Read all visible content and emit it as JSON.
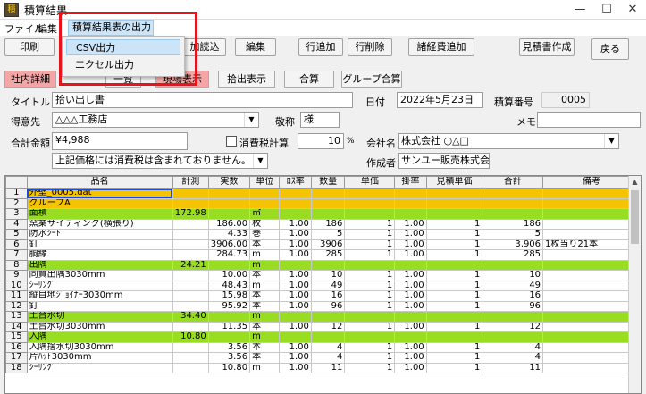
{
  "window": {
    "title": "積算結果",
    "app_icon": "積"
  },
  "menu": {
    "file": "ファイル",
    "edit": "編集",
    "export_menu": "積算結果表の出力"
  },
  "export_dropdown": {
    "csv": "CSV出力",
    "excel": "エクセル出力"
  },
  "toolbar": {
    "print": "印刷",
    "import_partial": "加読込",
    "edit": "編集",
    "add_row": "行追加",
    "delete_row": "行削除",
    "add_expense": "諸経費追加",
    "create_estimate": "見積書作成",
    "back": "戻る"
  },
  "tabs": {
    "internal_detail": "社内詳細",
    "tab2": "一覧",
    "tab3": "現場表示",
    "extract_display": "拾出表示",
    "total": "合算",
    "group_total": "グループ合算"
  },
  "form": {
    "title_label": "タイトル",
    "title_value": "拾い出し書",
    "date_label": "日付",
    "date_value": "2022年5月23日",
    "estimate_no_label": "積算番号",
    "estimate_no_value": "0005",
    "customer_label": "得意先",
    "customer_value": "△△△工務店",
    "honorific_label": "敬称",
    "honorific_value": "様",
    "memo_label": "メモ",
    "memo_value": "",
    "total_label": "合計金額",
    "total_value": "¥4,988",
    "tax_label": "消費税計算",
    "tax_rate": "10",
    "tax_unit": "%",
    "company_label": "会社名",
    "company_value": "株式会社 ○△□",
    "tax_note": "上記価格には消費税は含まれておりません。",
    "author_label": "作成者",
    "author_value": "サンユー販売株式会社"
  },
  "grid": {
    "headers": [
      "",
      "品名",
      "計測",
      "実数",
      "単位",
      "ﾛｽ率",
      "数量",
      "単価",
      "掛率",
      "見積単価",
      "合計",
      "備考"
    ],
    "rows": [
      {
        "type": "yellow",
        "cells": [
          "1",
          "外壁_0005.dat",
          "",
          "",
          "",
          "",
          "",
          "",
          "",
          "",
          "",
          ""
        ]
      },
      {
        "type": "yellow",
        "cells": [
          "2",
          "グループA",
          "",
          "",
          "",
          "",
          "",
          "",
          "",
          "",
          "",
          ""
        ]
      },
      {
        "type": "green",
        "cells": [
          "3",
          "面積",
          "172.98",
          "",
          "㎡",
          "",
          "",
          "",
          "",
          "",
          "",
          ""
        ]
      },
      {
        "type": "white",
        "cells": [
          "4",
          "窯業サイディング(横張り)",
          "",
          "186.00",
          "枚",
          "1.00",
          "186",
          "1",
          "1.00",
          "1",
          "186",
          ""
        ]
      },
      {
        "type": "white",
        "cells": [
          "5",
          "防水ｼｰﾄ",
          "",
          "4.33",
          "巻",
          "1.00",
          "5",
          "1",
          "1.00",
          "1",
          "5",
          ""
        ]
      },
      {
        "type": "white",
        "cells": [
          "6",
          "釘",
          "",
          "3906.00",
          "本",
          "1.00",
          "3906",
          "1",
          "1.00",
          "1",
          "3,906",
          "1枚当り21本"
        ]
      },
      {
        "type": "white",
        "cells": [
          "7",
          "胴縁",
          "",
          "284.73",
          "m",
          "1.00",
          "285",
          "1",
          "1.00",
          "1",
          "285",
          ""
        ]
      },
      {
        "type": "green",
        "cells": [
          "8",
          "出隅",
          "24.21",
          "",
          "m",
          "",
          "",
          "",
          "",
          "",
          "",
          ""
        ]
      },
      {
        "type": "white",
        "cells": [
          "9",
          "同質出隅3030mm",
          "",
          "10.00",
          "本",
          "1.00",
          "10",
          "1",
          "1.00",
          "1",
          "10",
          ""
        ]
      },
      {
        "type": "white",
        "cells": [
          "10",
          "ｼｰﾘﾝｸﾞ",
          "",
          "48.43",
          "m",
          "1.00",
          "49",
          "1",
          "1.00",
          "1",
          "49",
          ""
        ]
      },
      {
        "type": "white",
        "cells": [
          "11",
          "縦目地ｼﾞｮｲﾅｰ3030mm",
          "",
          "15.98",
          "本",
          "1.00",
          "16",
          "1",
          "1.00",
          "1",
          "16",
          ""
        ]
      },
      {
        "type": "white",
        "cells": [
          "12",
          "釘",
          "",
          "95.92",
          "本",
          "1.00",
          "96",
          "1",
          "1.00",
          "1",
          "96",
          ""
        ]
      },
      {
        "type": "green",
        "cells": [
          "13",
          "土台水切",
          "34.40",
          "",
          "m",
          "",
          "",
          "",
          "",
          "",
          "",
          ""
        ]
      },
      {
        "type": "white",
        "cells": [
          "14",
          "土台水切3030mm",
          "",
          "11.35",
          "本",
          "1.00",
          "12",
          "1",
          "1.00",
          "1",
          "12",
          ""
        ]
      },
      {
        "type": "green",
        "cells": [
          "15",
          "入隅",
          "10.80",
          "",
          "m",
          "",
          "",
          "",
          "",
          "",
          "",
          ""
        ]
      },
      {
        "type": "white",
        "cells": [
          "16",
          "入隅捨水切3030mm",
          "",
          "3.56",
          "本",
          "1.00",
          "4",
          "1",
          "1.00",
          "1",
          "4",
          ""
        ]
      },
      {
        "type": "white",
        "cells": [
          "17",
          "片ﾊｯﾄ3030mm",
          "",
          "3.56",
          "本",
          "1.00",
          "4",
          "1",
          "1.00",
          "1",
          "4",
          ""
        ]
      },
      {
        "type": "white",
        "cells": [
          "18",
          "ｼｰﾘﾝｸﾞ",
          "",
          "10.80",
          "m",
          "1.00",
          "11",
          "1",
          "1.00",
          "1",
          "11",
          ""
        ]
      }
    ]
  }
}
